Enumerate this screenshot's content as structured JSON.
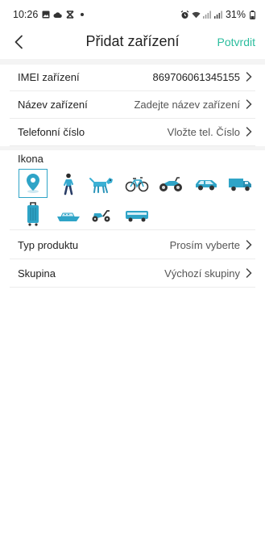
{
  "status_bar": {
    "time": "10:26",
    "left_icons": [
      "image-icon",
      "cloud-icon",
      "x-sync-icon",
      "dot-icon"
    ],
    "right_icons": [
      "alarm-icon",
      "wifi-icon",
      "signal-icon",
      "signal-icon",
      "battery-icon"
    ],
    "battery": "31%"
  },
  "header": {
    "title": "Přidat zařízení",
    "confirm_label": "Potvrdit"
  },
  "form": {
    "imei": {
      "label": "IMEI zařízení",
      "value": "869706061345155"
    },
    "name": {
      "label": "Název zařízení",
      "placeholder": "Zadejte název zařízení"
    },
    "phone": {
      "label": "Telefonní číslo",
      "placeholder": "Vložte tel. Číslo"
    },
    "icon_section": {
      "label": "Ikona",
      "icons": [
        "location-pin-icon",
        "person-walking-icon",
        "dog-icon",
        "bicycle-icon",
        "motorcycle-icon",
        "car-icon",
        "truck-icon",
        "suitcase-icon",
        "boat-icon",
        "scooter-icon",
        "bus-icon"
      ],
      "selected": "location-pin-icon"
    },
    "product_type": {
      "label": "Typ produktu",
      "value": "Prosím vyberte"
    },
    "group": {
      "label": "Skupina",
      "value": "Výchozí skupiny"
    }
  },
  "colors": {
    "accent": "#2bbd9e",
    "icon_blue": "#2fa4c7",
    "separator": "#f4f4f4"
  }
}
